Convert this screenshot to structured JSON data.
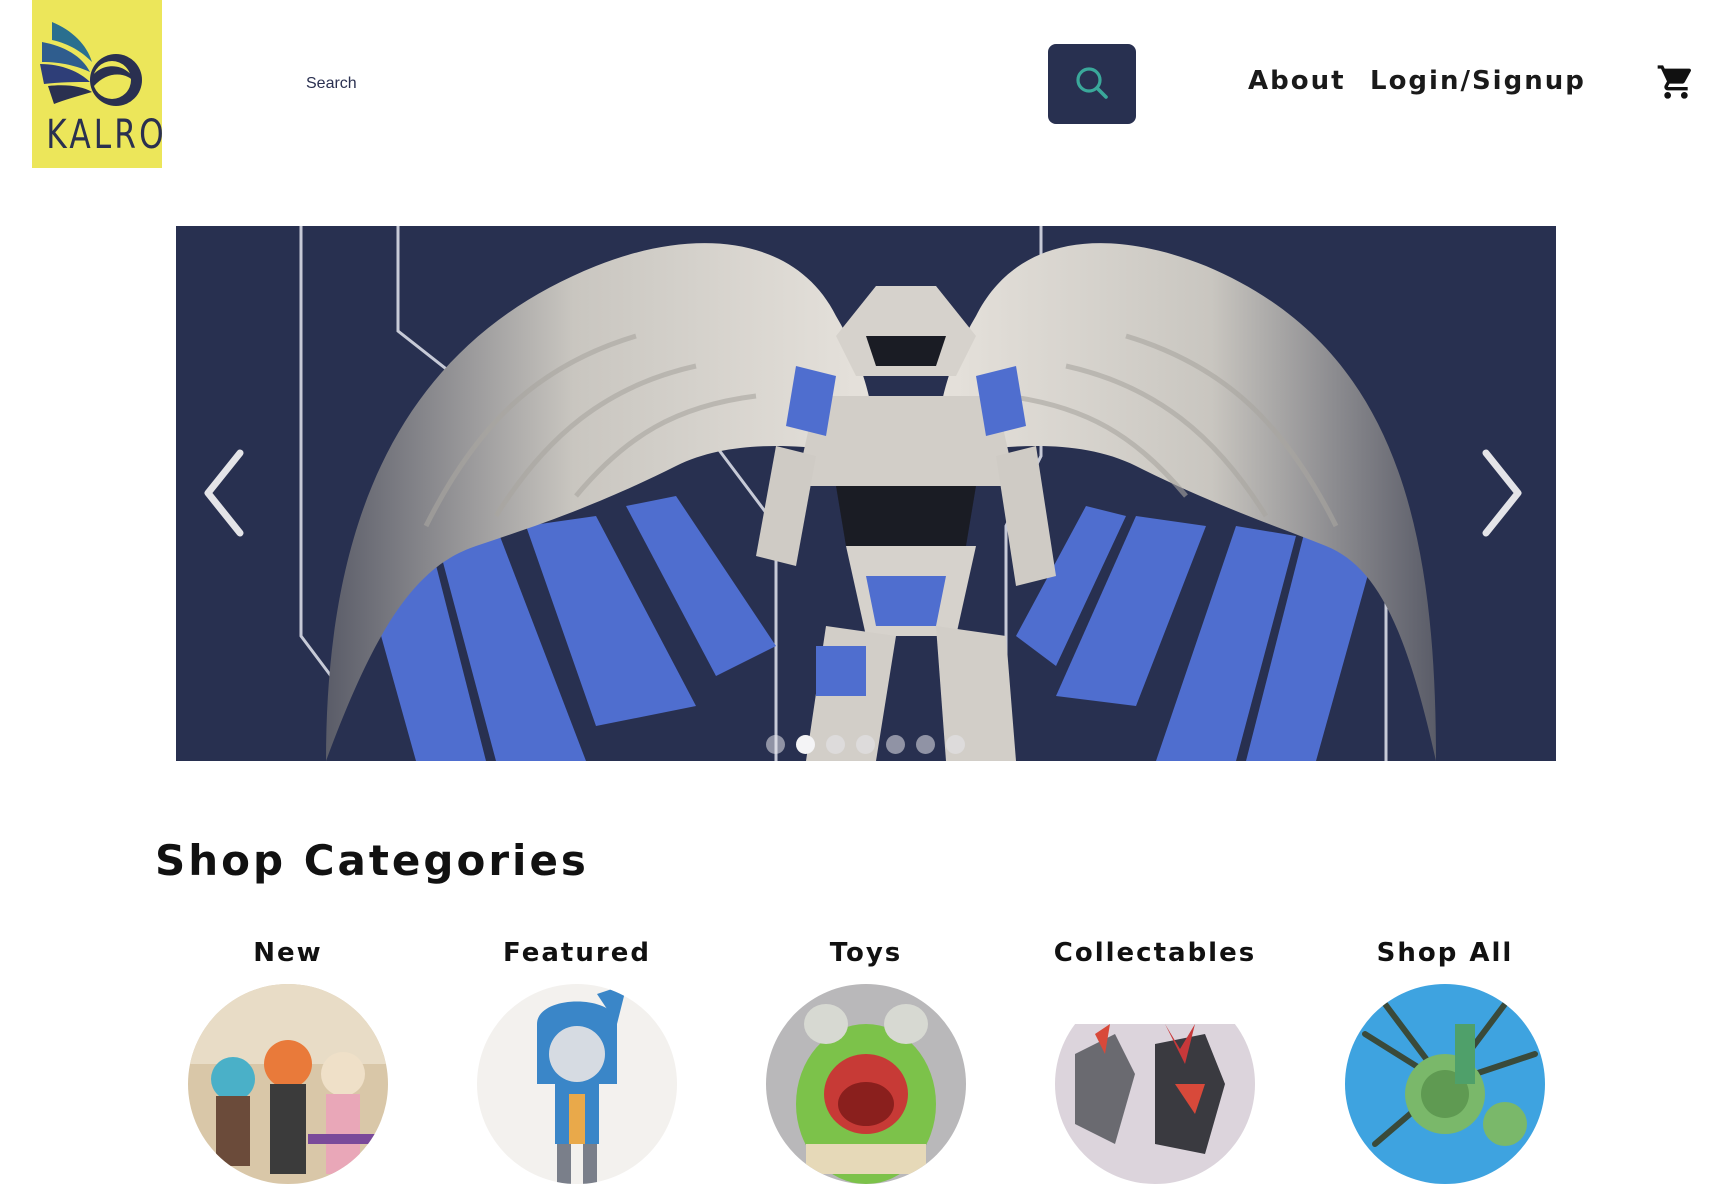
{
  "brand": {
    "name": "KALRO",
    "logo_bg": "#ece65a",
    "logo_fg": "#2a3050"
  },
  "search": {
    "placeholder": "Search",
    "value": "",
    "icon": "search-icon"
  },
  "nav": {
    "about": "About",
    "login": "Login/Signup",
    "cart_icon": "cart-icon"
  },
  "hero": {
    "prev_icon": "chevron-left-icon",
    "next_icon": "chevron-right-icon",
    "slide_count": 7,
    "active_slide": 2,
    "bg": "#283050",
    "accent": "#5472d3"
  },
  "categories": {
    "title": "Shop Categories",
    "items": [
      {
        "label": "New"
      },
      {
        "label": "Featured"
      },
      {
        "label": "Toys"
      },
      {
        "label": "Collectables"
      },
      {
        "label": "Shop All"
      }
    ]
  },
  "colors": {
    "primary": "#283050",
    "accent_yellow": "#ece65a",
    "search_icon": "#3aa89a"
  }
}
